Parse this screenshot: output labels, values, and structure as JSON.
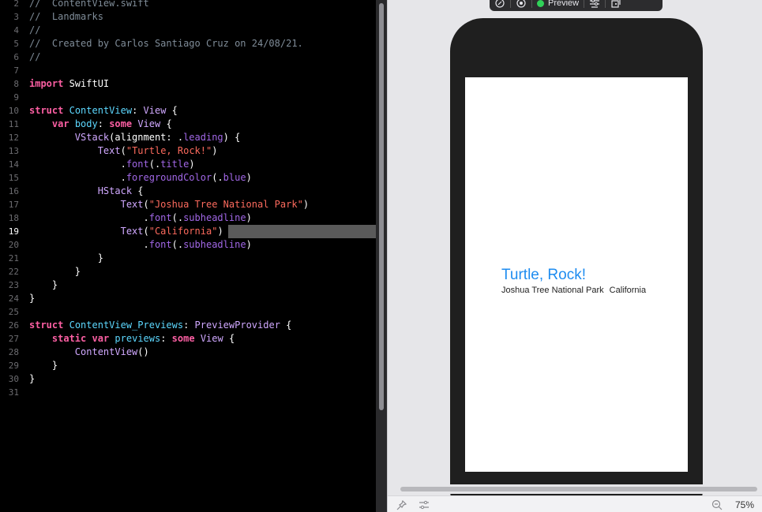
{
  "editor": {
    "lines": [
      {
        "n": "2",
        "tokens": [
          {
            "t": "//  ContentView.swift",
            "c": "c"
          }
        ]
      },
      {
        "n": "3",
        "tokens": [
          {
            "t": "//  Landmarks",
            "c": "c"
          }
        ]
      },
      {
        "n": "4",
        "tokens": [
          {
            "t": "//",
            "c": "c"
          }
        ]
      },
      {
        "n": "5",
        "tokens": [
          {
            "t": "//  Created by Carlos Santiago Cruz on 24/08/21.",
            "c": "c"
          }
        ]
      },
      {
        "n": "6",
        "tokens": [
          {
            "t": "//",
            "c": "c"
          }
        ]
      },
      {
        "n": "7",
        "tokens": []
      },
      {
        "n": "8",
        "tokens": [
          {
            "t": "import",
            "c": "k"
          },
          {
            "t": " SwiftUI",
            "c": "d"
          }
        ]
      },
      {
        "n": "9",
        "tokens": []
      },
      {
        "n": "10",
        "tokens": [
          {
            "t": "struct",
            "c": "k"
          },
          {
            "t": " ",
            "c": "d"
          },
          {
            "t": "ContentView",
            "c": "t"
          },
          {
            "t": ": ",
            "c": "d"
          },
          {
            "t": "View",
            "c": "p"
          },
          {
            "t": " {",
            "c": "d"
          }
        ]
      },
      {
        "n": "11",
        "tokens": [
          {
            "t": "    ",
            "c": "d"
          },
          {
            "t": "var",
            "c": "k"
          },
          {
            "t": " ",
            "c": "d"
          },
          {
            "t": "body",
            "c": "t"
          },
          {
            "t": ": ",
            "c": "d"
          },
          {
            "t": "some",
            "c": "k"
          },
          {
            "t": " ",
            "c": "d"
          },
          {
            "t": "View",
            "c": "p"
          },
          {
            "t": " {",
            "c": "d"
          }
        ]
      },
      {
        "n": "12",
        "tokens": [
          {
            "t": "        ",
            "c": "d"
          },
          {
            "t": "VStack",
            "c": "p"
          },
          {
            "t": "(alignment: .",
            "c": "d"
          },
          {
            "t": "leading",
            "c": "f"
          },
          {
            "t": ") {",
            "c": "d"
          }
        ]
      },
      {
        "n": "13",
        "tokens": [
          {
            "t": "            ",
            "c": "d"
          },
          {
            "t": "Text",
            "c": "p"
          },
          {
            "t": "(",
            "c": "d"
          },
          {
            "t": "\"Turtle, Rock!\"",
            "c": "s"
          },
          {
            "t": ")",
            "c": "d"
          }
        ]
      },
      {
        "n": "14",
        "tokens": [
          {
            "t": "                .",
            "c": "d"
          },
          {
            "t": "font",
            "c": "f"
          },
          {
            "t": "(.",
            "c": "d"
          },
          {
            "t": "title",
            "c": "f"
          },
          {
            "t": ")",
            "c": "d"
          }
        ]
      },
      {
        "n": "15",
        "tokens": [
          {
            "t": "                .",
            "c": "d"
          },
          {
            "t": "foregroundColor",
            "c": "f"
          },
          {
            "t": "(.",
            "c": "d"
          },
          {
            "t": "blue",
            "c": "f"
          },
          {
            "t": ")",
            "c": "d"
          }
        ]
      },
      {
        "n": "16",
        "tokens": [
          {
            "t": "            ",
            "c": "d"
          },
          {
            "t": "HStack",
            "c": "p"
          },
          {
            "t": " {",
            "c": "d"
          }
        ]
      },
      {
        "n": "17",
        "tokens": [
          {
            "t": "                ",
            "c": "d"
          },
          {
            "t": "Text",
            "c": "p"
          },
          {
            "t": "(",
            "c": "d"
          },
          {
            "t": "\"Joshua Tree National Park\"",
            "c": "s"
          },
          {
            "t": ")",
            "c": "d"
          }
        ]
      },
      {
        "n": "18",
        "tokens": [
          {
            "t": "                    .",
            "c": "d"
          },
          {
            "t": "font",
            "c": "f"
          },
          {
            "t": "(.",
            "c": "d"
          },
          {
            "t": "subheadline",
            "c": "f"
          },
          {
            "t": ")",
            "c": "d"
          }
        ]
      },
      {
        "n": "19",
        "current": true,
        "tokens": [
          {
            "t": "                ",
            "c": "d"
          },
          {
            "t": "Text",
            "c": "p"
          },
          {
            "t": "(",
            "c": "d"
          },
          {
            "t": "\"California\"",
            "c": "s"
          },
          {
            "t": ")",
            "c": "d"
          }
        ]
      },
      {
        "n": "20",
        "tokens": [
          {
            "t": "                    .",
            "c": "d"
          },
          {
            "t": "font",
            "c": "f"
          },
          {
            "t": "(.",
            "c": "d"
          },
          {
            "t": "subheadline",
            "c": "f"
          },
          {
            "t": ")",
            "c": "d"
          }
        ]
      },
      {
        "n": "21",
        "tokens": [
          {
            "t": "            }",
            "c": "d"
          }
        ]
      },
      {
        "n": "22",
        "tokens": [
          {
            "t": "        }",
            "c": "d"
          }
        ]
      },
      {
        "n": "23",
        "tokens": [
          {
            "t": "    }",
            "c": "d"
          }
        ]
      },
      {
        "n": "24",
        "tokens": [
          {
            "t": "}",
            "c": "d"
          }
        ]
      },
      {
        "n": "25",
        "tokens": []
      },
      {
        "n": "26",
        "tokens": [
          {
            "t": "struct",
            "c": "k"
          },
          {
            "t": " ",
            "c": "d"
          },
          {
            "t": "ContentView_Previews",
            "c": "t"
          },
          {
            "t": ": ",
            "c": "d"
          },
          {
            "t": "PreviewProvider",
            "c": "p"
          },
          {
            "t": " {",
            "c": "d"
          }
        ]
      },
      {
        "n": "27",
        "tokens": [
          {
            "t": "    ",
            "c": "d"
          },
          {
            "t": "static",
            "c": "k"
          },
          {
            "t": " ",
            "c": "d"
          },
          {
            "t": "var",
            "c": "k"
          },
          {
            "t": " ",
            "c": "d"
          },
          {
            "t": "previews",
            "c": "t"
          },
          {
            "t": ": ",
            "c": "d"
          },
          {
            "t": "some",
            "c": "k"
          },
          {
            "t": " ",
            "c": "d"
          },
          {
            "t": "View",
            "c": "p"
          },
          {
            "t": " {",
            "c": "d"
          }
        ]
      },
      {
        "n": "28",
        "tokens": [
          {
            "t": "        ",
            "c": "d"
          },
          {
            "t": "ContentView",
            "c": "p"
          },
          {
            "t": "()",
            "c": "d"
          }
        ]
      },
      {
        "n": "29",
        "tokens": [
          {
            "t": "    }",
            "c": "d"
          }
        ]
      },
      {
        "n": "30",
        "tokens": [
          {
            "t": "}",
            "c": "d"
          }
        ]
      },
      {
        "n": "31",
        "tokens": []
      }
    ]
  },
  "preview": {
    "toolbar": {
      "live_label": "Preview",
      "icons": [
        "live-preview-icon",
        "inspect-icon",
        "device-settings-icon",
        "duplicate-preview-icon"
      ]
    },
    "screen": {
      "title": "Turtle, Rock!",
      "park": "Joshua Tree National Park",
      "state": "California"
    },
    "colors": {
      "title_blue": "#1e8cf0",
      "live_green": "#30d158"
    }
  },
  "bottom_bar": {
    "icons": [
      "pin-icon",
      "variants-icon",
      "zoom-out-icon"
    ],
    "zoom": "75%"
  }
}
